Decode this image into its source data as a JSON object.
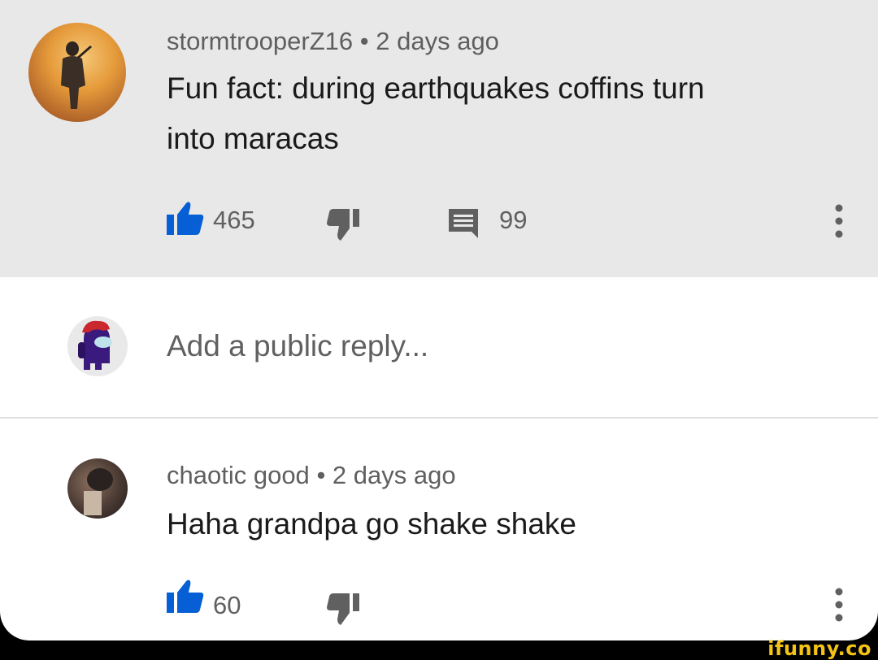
{
  "comment": {
    "username": "stormtrooperZ16",
    "separator": "•",
    "time": "2 days ago",
    "text_line1": "Fun fact: during earthquakes coffins turn",
    "text_line2": "into maracas",
    "likes": "465",
    "replies": "99"
  },
  "reply_box": {
    "placeholder": "Add a public reply..."
  },
  "reply": {
    "username": "chaotic good",
    "separator": "•",
    "time": "2 days ago",
    "text": "Haha grandpa go shake shake",
    "likes": "60"
  },
  "watermark": "ifunny.co",
  "colors": {
    "like_blue": "#065fd4",
    "icon_gray": "#606060",
    "highlight_bg": "#e8e8e8"
  }
}
